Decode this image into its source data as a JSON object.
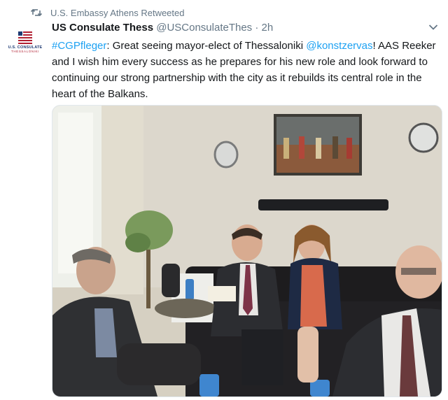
{
  "retweet": {
    "label": "U.S. Embassy Athens Retweeted",
    "icon": "retweet-icon"
  },
  "avatar": {
    "line1": "U.S. CONSULATE",
    "line2": "THESSALONIKI"
  },
  "tweet": {
    "display_name": "US Consulate Thess",
    "handle": "@USConsulateThes",
    "separator": "·",
    "time": "2h",
    "text_parts": {
      "hashtag": "#CGPfleger",
      "t1": ": Great seeing mayor-elect of Thessaloniki ",
      "mention": "@konstzervas",
      "t2": "! AAS Reeker and I wish him every success as he prepares for his new role and look forward to continuing our strong partnership with the city as it rebuilds its central role in the heart of the Balkans."
    }
  },
  "colors": {
    "link": "#1da1f2",
    "muted": "#657786",
    "text": "#14171a"
  }
}
